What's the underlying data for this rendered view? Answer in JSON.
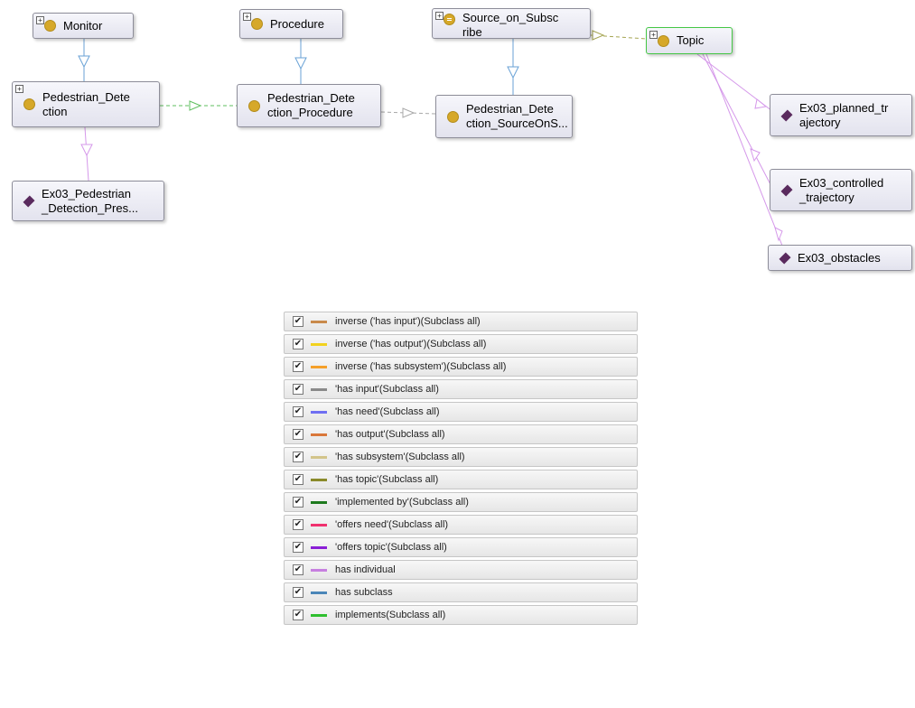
{
  "nodes": {
    "monitor": {
      "label": "Monitor",
      "kind": "class",
      "expandable": true
    },
    "procedure": {
      "label": "Procedure",
      "kind": "class",
      "expandable": true
    },
    "source_on_subscribe": {
      "label": "Source_on_Subsc\nribe",
      "kind": "equivalent-class",
      "expandable": true
    },
    "topic": {
      "label": "Topic",
      "kind": "class",
      "expandable": true,
      "selected": true
    },
    "pedestrian_detection": {
      "label": "Pedestrian_Dete\nction",
      "kind": "class",
      "expandable": true
    },
    "pedestrian_detection_procedure": {
      "label": "Pedestrian_Dete\nction_Procedure",
      "kind": "class",
      "expandable": false
    },
    "pedestrian_detection_sourceons": {
      "label": "Pedestrian_Dete\nction_SourceOnS...",
      "kind": "class",
      "expandable": false
    },
    "ex03_pedestrian_detection_pres": {
      "label": "Ex03_Pedestrian\n_Detection_Pres...",
      "kind": "individual",
      "expandable": false
    },
    "ex03_planned_trajectory": {
      "label": "Ex03_planned_tr\najectory",
      "kind": "individual",
      "expandable": false
    },
    "ex03_controlled_trajectory": {
      "label": "Ex03_controlled\n_trajectory",
      "kind": "individual",
      "expandable": false
    },
    "ex03_obstacles": {
      "label": "Ex03_obstacles",
      "kind": "individual",
      "expandable": false
    }
  },
  "icons": {
    "expand": "plus-box-icon",
    "class": "class-circle-icon",
    "equivalent_class": "equivalent-class-icon",
    "individual": "individual-diamond-icon",
    "checkbox": "checkbox-checked-icon"
  },
  "edges": [
    {
      "from": "monitor",
      "to": "pedestrian_detection",
      "relation": "has subclass"
    },
    {
      "from": "procedure",
      "to": "pedestrian_detection_procedure",
      "relation": "has subclass"
    },
    {
      "from": "source_on_subscribe",
      "to": "pedestrian_detection_sourceons",
      "relation": "has subclass"
    },
    {
      "from": "pedestrian_detection",
      "to": "pedestrian_detection_procedure",
      "relation": "implemented by"
    },
    {
      "from": "pedestrian_detection_procedure",
      "to": "pedestrian_detection_sourceons",
      "relation": "has input"
    },
    {
      "from": "source_on_subscribe",
      "to": "topic",
      "relation": "has topic"
    },
    {
      "from": "pedestrian_detection",
      "to": "ex03_pedestrian_detection_pres",
      "relation": "has individual"
    },
    {
      "from": "topic",
      "to": "ex03_planned_trajectory",
      "relation": "has individual"
    },
    {
      "from": "topic",
      "to": "ex03_controlled_trajectory",
      "relation": "has individual"
    },
    {
      "from": "topic",
      "to": "ex03_obstacles",
      "relation": "has individual"
    }
  ],
  "legend": [
    {
      "label": "inverse ('has input')(Subclass all)",
      "color": "#c98a4b",
      "checked": true
    },
    {
      "label": "inverse ('has output')(Subclass all)",
      "color": "#f2d21f",
      "checked": true
    },
    {
      "label": "inverse ('has subsystem')(Subclass all)",
      "color": "#f5a02a",
      "checked": true
    },
    {
      "label": "'has input'(Subclass all)",
      "color": "#8a8a8a",
      "checked": true
    },
    {
      "label": "'has need'(Subclass all)",
      "color": "#6f6ff2",
      "checked": true
    },
    {
      "label": "'has output'(Subclass all)",
      "color": "#d9773a",
      "checked": true
    },
    {
      "label": "'has subsystem'(Subclass all)",
      "color": "#d3c48a",
      "checked": true
    },
    {
      "label": "'has topic'(Subclass all)",
      "color": "#8a8a2a",
      "checked": true
    },
    {
      "label": "'implemented by'(Subclass all)",
      "color": "#1e7a1e",
      "checked": true
    },
    {
      "label": "'offers need'(Subclass all)",
      "color": "#f0306e",
      "checked": true
    },
    {
      "label": "'offers topic'(Subclass all)",
      "color": "#8a1fd6",
      "checked": true
    },
    {
      "label": "has individual",
      "color": "#c77fe0",
      "checked": true
    },
    {
      "label": "has subclass",
      "color": "#4a86b8",
      "checked": true
    },
    {
      "label": "implements(Subclass all)",
      "color": "#2fbf2f",
      "checked": true
    }
  ]
}
